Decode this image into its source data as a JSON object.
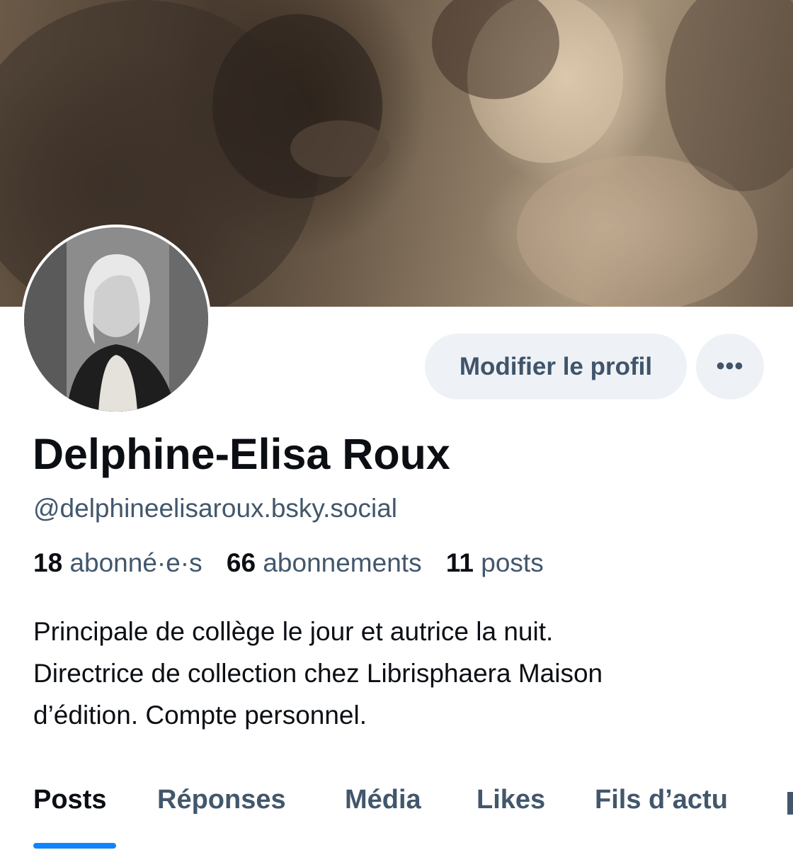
{
  "profile": {
    "display_name": "Delphine-Elisa Roux",
    "handle": "@delphineelisaroux.bsky.social",
    "bio_lines": [
      "Principale de collège le jour et autrice la nuit.",
      "Directrice de collection chez Librisphaera Maison",
      "d’édition. Compte personnel."
    ]
  },
  "actions": {
    "edit_label": "Modifier le profil",
    "more_label": "•••"
  },
  "stats": {
    "followers_count": "18",
    "followers_label": "abonné·e·s",
    "following_count": "66",
    "following_label": "abonnements",
    "posts_count": "11",
    "posts_label": "posts"
  },
  "tabs": [
    {
      "label": "Posts",
      "active": true
    },
    {
      "label": "Réponses",
      "active": false
    },
    {
      "label": "Média",
      "active": false
    },
    {
      "label": "Likes",
      "active": false
    },
    {
      "label": "Fils d’actu",
      "active": false
    }
  ],
  "colors": {
    "accent": "#1083fe",
    "text_primary": "#0b0f14",
    "text_secondary": "#42576c",
    "button_bg": "#eef2f6"
  }
}
